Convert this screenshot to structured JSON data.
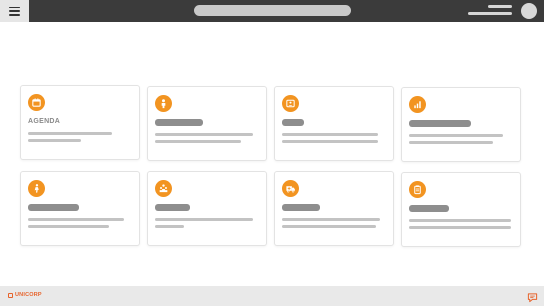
{
  "header": {
    "menu_icon": "hamburger-icon",
    "search_placeholder": "",
    "avatar_icon": "user-avatar"
  },
  "cards": [
    {
      "title": "AGENDA",
      "icon": "calendar-icon"
    },
    {
      "title": "",
      "icon": "person-icon"
    },
    {
      "title": "",
      "icon": "id-card-icon"
    },
    {
      "title": "",
      "icon": "bar-chart-icon"
    },
    {
      "title": "",
      "icon": "walking-person-icon"
    },
    {
      "title": "",
      "icon": "group-icon"
    },
    {
      "title": "",
      "icon": "ambulance-icon"
    },
    {
      "title": "",
      "icon": "clipboard-icon"
    }
  ],
  "footer": {
    "brand": "UNICORP",
    "chat_icon": "chat-icon"
  },
  "colors": {
    "topbar": "#3b3b3b",
    "accent": "#f29421",
    "brand": "#e7632b",
    "footer": "#e9e9e9"
  }
}
